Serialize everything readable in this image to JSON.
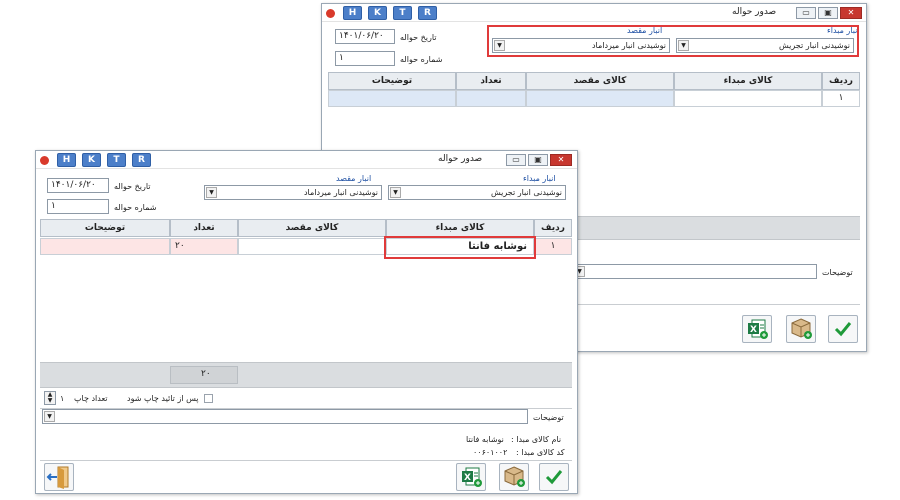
{
  "toolbar_letters": [
    "H",
    "K",
    "T",
    "R"
  ],
  "window_title": "صدور حواله",
  "window_controls": {
    "minimize": "▭",
    "restore": "▣",
    "close": "✕"
  },
  "form": {
    "date_label": "تاریخ حواله",
    "date_value": "۱۴۰۱/۰۶/۲۰",
    "number_label": "شماره حواله",
    "number_value": "۱",
    "source_store_label": "انبار مبداء",
    "source_store_value": "نوشیدنی انبار تجریش",
    "dest_store_label": "انبار مقصد",
    "dest_store_value": "نوشیدنی انبار میرداماد"
  },
  "grid": {
    "headers": {
      "row": "ردیف",
      "source_item": "کالای مبداء",
      "dest_item": "کالای مقصد",
      "qty": "تعداد",
      "desc": "توضیحات"
    },
    "back_row": {
      "row": "۱",
      "source_item": "",
      "dest_item": "",
      "qty": "",
      "desc": ""
    },
    "front_row": {
      "row": "۱",
      "source_item": "نوشابه فانتا",
      "dest_item": "",
      "qty": "۲۰",
      "desc": ""
    },
    "total_qty": "۲۰"
  },
  "print": {
    "after_confirm_label": "پس از تائید چاپ شود",
    "print_count_label": "تعداد چاپ",
    "print_count_value": "۱"
  },
  "desc_label": "توضیحات",
  "info": {
    "source_name_label": "نام کالای مبدا :",
    "source_name_value": "نوشابه فانتا",
    "source_code_label": "کد کالای مبدا :",
    "source_code_value": "۰۰۶۰۱۰۰۲"
  },
  "colors": {
    "accent_red": "#e03a3a",
    "letter_blue": "#4c7fc9",
    "ok_green": "#1f9a3a",
    "excel_green": "#1e7b45"
  }
}
